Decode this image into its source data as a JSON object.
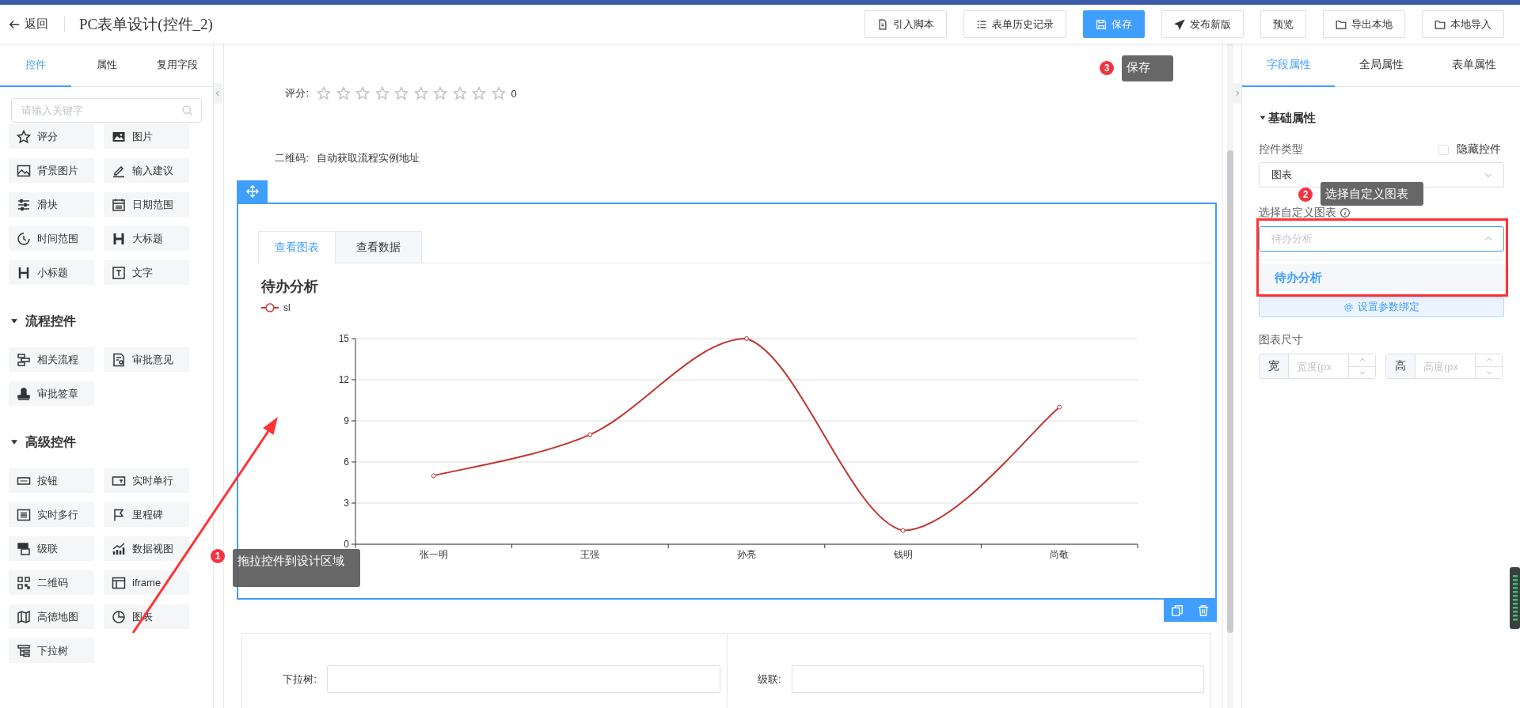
{
  "header": {
    "back": "返回",
    "title": "PC表单设计(控件_2)",
    "buttons": [
      {
        "label": "引入脚本",
        "kind": "script",
        "primary": false
      },
      {
        "label": "表单历史记录",
        "kind": "history",
        "primary": false
      },
      {
        "label": "保存",
        "kind": "save",
        "primary": true
      },
      {
        "label": "发布新版",
        "kind": "publish",
        "primary": false
      },
      {
        "label": "预览",
        "kind": "preview",
        "primary": false
      },
      {
        "label": "导出本地",
        "kind": "export",
        "primary": false
      },
      {
        "label": "本地导入",
        "kind": "import",
        "primary": false
      }
    ]
  },
  "left_panel": {
    "tabs": [
      {
        "label": "控件",
        "selected": true
      },
      {
        "label": "属性",
        "selected": false
      },
      {
        "label": "复用字段",
        "selected": false
      }
    ],
    "search": {
      "placeholder": "请输入关键字"
    },
    "groups": [
      {
        "items": [
          {
            "label": "评分",
            "kind": "rating"
          },
          {
            "label": "图片",
            "kind": "image"
          },
          {
            "label": "背景图片",
            "kind": "bgimage"
          },
          {
            "label": "输入建议",
            "kind": "suggest"
          },
          {
            "label": "滑块",
            "kind": "slider"
          },
          {
            "label": "日期范围",
            "kind": "daterange"
          },
          {
            "label": "时间范围",
            "kind": "timerange"
          },
          {
            "label": "大标题",
            "kind": "heading"
          },
          {
            "label": "小标题",
            "kind": "subheading"
          },
          {
            "label": "文字",
            "kind": "text"
          }
        ]
      },
      {
        "title": "流程控件",
        "expanded": true,
        "items": [
          {
            "label": "相关流程",
            "kind": "flow"
          },
          {
            "label": "审批意见",
            "kind": "opinion"
          },
          {
            "label": "审批签章",
            "kind": "seal"
          }
        ]
      },
      {
        "title": "高级控件",
        "expanded": true,
        "items": [
          {
            "label": "按钮",
            "kind": "button"
          },
          {
            "label": "实时单行",
            "kind": "single"
          },
          {
            "label": "实时多行",
            "kind": "multi"
          },
          {
            "label": "里程碑",
            "kind": "milestone"
          },
          {
            "label": "级联",
            "kind": "cascade"
          },
          {
            "label": "数据视图",
            "kind": "dataview"
          },
          {
            "label": "二维码",
            "kind": "qrcode"
          },
          {
            "label": "iframe",
            "kind": "iframe"
          },
          {
            "label": "高德地图",
            "kind": "map"
          },
          {
            "label": "图表",
            "kind": "chart"
          },
          {
            "label": "下拉树",
            "kind": "treeselect"
          }
        ]
      }
    ]
  },
  "canvas": {
    "rating_field": {
      "label": "评分:",
      "stars": 0,
      "value": "0"
    },
    "qrcode_field": {
      "label": "二维码:",
      "value": "自动获取流程实例地址"
    },
    "chart_widget": {
      "tabs": [
        {
          "label": "查看图表",
          "selected": true
        },
        {
          "label": "查看数据",
          "selected": false
        }
      ],
      "chart_data": {
        "type": "line",
        "title": "待办分析",
        "categories": [
          "张一明",
          "王强",
          "孙亮",
          "钱明",
          "尚敬"
        ],
        "series": [
          {
            "name": "sl",
            "color": "#c23531",
            "marker": "circle",
            "values": [
              5,
              8,
              15,
              1,
              10
            ]
          }
        ],
        "grid": true,
        "ylim": [
          0,
          15
        ],
        "yticks": [
          0,
          3,
          6,
          9,
          12,
          15
        ]
      }
    },
    "form_row": [
      {
        "label": "下拉树:"
      },
      {
        "label": "级联:"
      }
    ]
  },
  "right_panel": {
    "tabs": [
      {
        "label": "字段属性",
        "selected": true
      },
      {
        "label": "全局属性",
        "selected": false
      },
      {
        "label": "表单属性",
        "selected": false
      }
    ],
    "section": {
      "title": "基础属性",
      "expanded": true
    },
    "control_type": {
      "label": "控件类型",
      "value": "图表"
    },
    "hide_control": {
      "label": "隐藏控件",
      "checked": false
    },
    "custom_chart": {
      "label": "选择自定义图表",
      "placeholder": "待办分析",
      "expanded": true,
      "options": [
        {
          "label": "待办分析",
          "selected": true
        }
      ]
    },
    "bind_button": "设置参数绑定",
    "chart_size": {
      "label": "图表尺寸",
      "width": {
        "addon": "宽",
        "placeholder": "宽度(px"
      },
      "height": {
        "addon": "高",
        "placeholder": "高度(px"
      }
    }
  },
  "annotations": [
    {
      "number": "1",
      "text": "拖拉控件到设计区域"
    },
    {
      "number": "2",
      "text": "选择自定义图表"
    },
    {
      "number": "3",
      "text": "保存"
    }
  ]
}
